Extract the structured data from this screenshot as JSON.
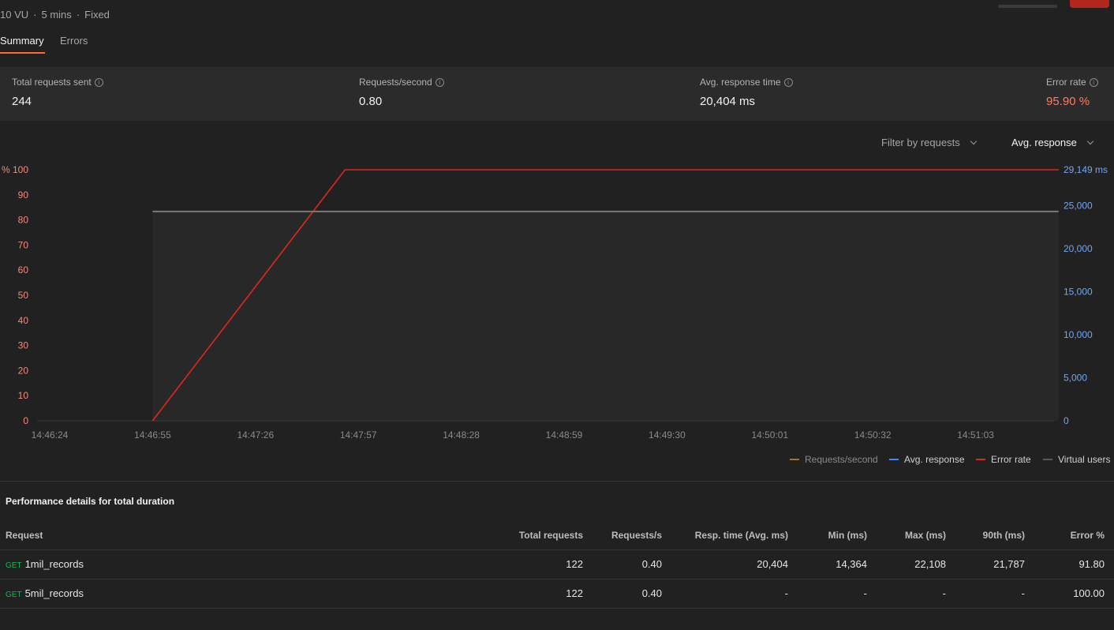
{
  "header": {
    "vu": "10 VU",
    "duration": "5 mins",
    "profile": "Fixed",
    "separator": "·"
  },
  "tabs": [
    {
      "label": "Summary",
      "active": true
    },
    {
      "label": "Errors",
      "active": false
    }
  ],
  "stats": [
    {
      "label": "Total requests sent",
      "value": "244"
    },
    {
      "label": "Requests/second",
      "value": "0.80"
    },
    {
      "label": "Avg. response time",
      "value": "20,404 ms"
    },
    {
      "label": "Error rate",
      "value": "95.90 %"
    }
  ],
  "filters": {
    "requests": "Filter by requests",
    "metric": "Avg. response"
  },
  "chart_data": {
    "type": "line",
    "x_ticks": [
      "14:46:24",
      "14:46:55",
      "14:47:26",
      "14:47:57",
      "14:48:28",
      "14:48:59",
      "14:49:30",
      "14:50:01",
      "14:50:32",
      "14:51:03"
    ],
    "y_left": {
      "unit": "%",
      "ticks": [
        0,
        10,
        20,
        30,
        40,
        50,
        60,
        70,
        80,
        90,
        100
      ],
      "ylim": [
        0,
        100
      ]
    },
    "y_right": {
      "unit": "ms",
      "tick_labels": [
        "0",
        "5,000",
        "10,000",
        "15,000",
        "20,000",
        "25,000",
        "29,149 ms"
      ],
      "ylim": [
        0,
        29149
      ]
    },
    "series": [
      {
        "name": "Error rate",
        "axis": "left",
        "color": "#e0271e",
        "points": [
          [
            "14:46:55",
            0
          ],
          [
            "14:47:53",
            100
          ],
          [
            "14:51:28",
            100
          ]
        ]
      },
      {
        "name": "Virtual users",
        "axis": "right",
        "color": "#7a7a7a",
        "points": [
          [
            "14:46:55",
            24300
          ],
          [
            "14:51:28",
            24300
          ]
        ]
      }
    ]
  },
  "legend": [
    {
      "name": "Requests/second",
      "color": "#a8732a",
      "text_color": "#8a8a8a"
    },
    {
      "name": "Avg. response",
      "color": "#3d8bf7",
      "text_color": "#d0d0d0"
    },
    {
      "name": "Error rate",
      "color": "#e0271e",
      "text_color": "#d0d0d0"
    },
    {
      "name": "Virtual users",
      "color": "#5a5a5a",
      "text_color": "#d0d0d0"
    }
  ],
  "performance": {
    "title": "Performance details for total duration",
    "columns": [
      "Request",
      "Total requests",
      "Requests/s",
      "Resp. time (Avg. ms)",
      "Min (ms)",
      "Max (ms)",
      "90th (ms)",
      "Error %"
    ],
    "rows": [
      {
        "method": "GET",
        "name": "1mil_records",
        "cells": [
          "122",
          "0.40",
          "20,404",
          "14,364",
          "22,108",
          "21,787",
          "91.80"
        ]
      },
      {
        "method": "GET",
        "name": "5mil_records",
        "cells": [
          "122",
          "0.40",
          "-",
          "-",
          "-",
          "-",
          "100.00"
        ]
      }
    ]
  },
  "colors": {
    "accent": "#ff6c37",
    "error_text": "#ff7b63",
    "left_axis": "#f28b7b",
    "right_axis": "#6fa8f5",
    "get_method": "#0cbb52"
  }
}
